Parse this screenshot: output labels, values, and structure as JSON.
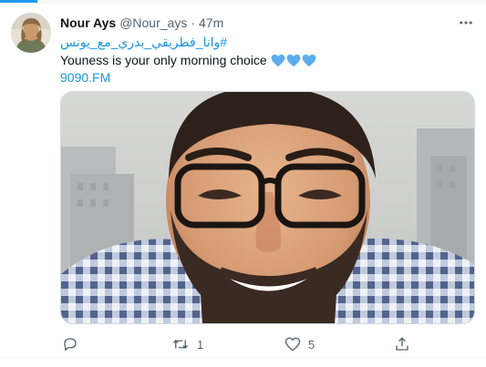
{
  "tweet": {
    "author": {
      "display_name": "Nour Ays",
      "handle": "@Nour_ays",
      "avatar_icon": "user-avatar-photo"
    },
    "separator": "·",
    "time": "47m",
    "more_icon": "more-horizontal-icon",
    "hashtag": "#وانا_فطريقي_بدري_مع_يونس",
    "text": "Youness is your only morning choice",
    "emojis": [
      "blue-heart",
      "blue-heart",
      "blue-heart"
    ],
    "link": "9090.FM",
    "media": {
      "type": "photo",
      "description_icon": "photo-of-smiling-man-with-glasses"
    },
    "actions": {
      "reply": {
        "icon": "reply-icon",
        "count": ""
      },
      "retweet": {
        "icon": "retweet-icon",
        "count": "1"
      },
      "like": {
        "icon": "heart-icon",
        "count": "5"
      },
      "share": {
        "icon": "share-icon",
        "count": ""
      }
    }
  },
  "colors": {
    "link_blue": "#1b95e0",
    "heart_blue": "#5dadec",
    "muted_text": "#536471",
    "primary_text": "#0f1419",
    "accent": "#1d9bf0"
  }
}
